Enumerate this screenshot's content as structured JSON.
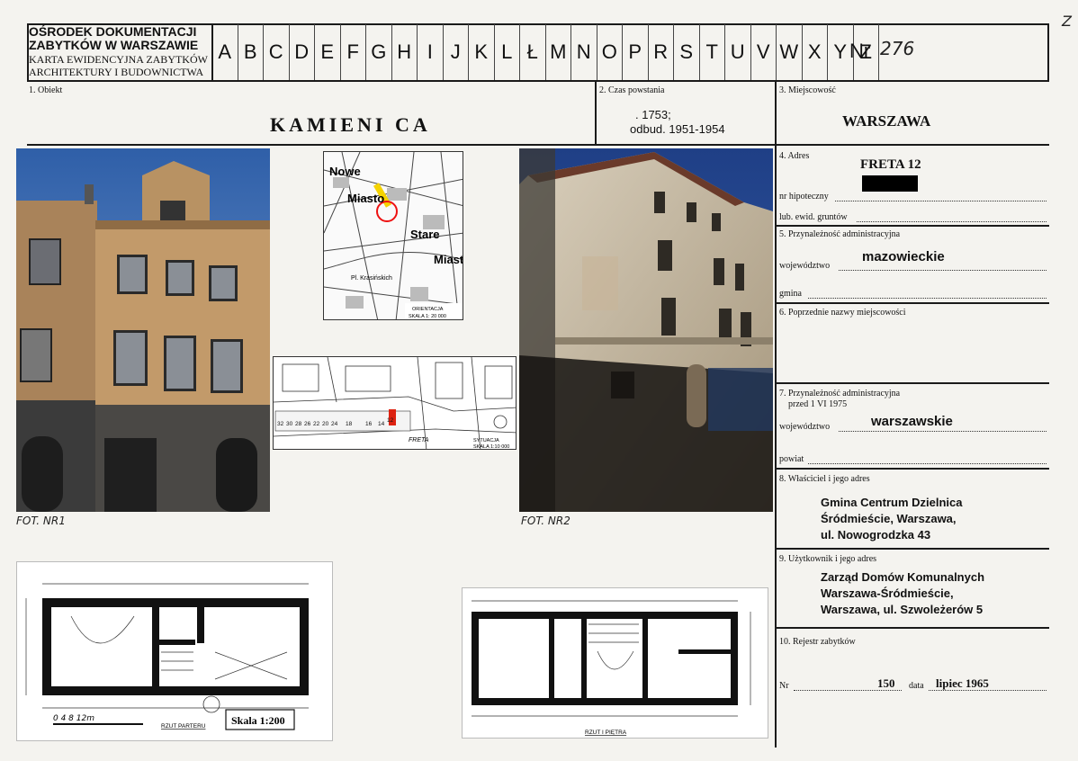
{
  "header": {
    "org_line1": "OŚRODEK DOKUMENTACJI",
    "org_line2": "ZABYTKÓW W WARSZAWIE",
    "card_line1": "KARTA EWIDENCYJNA ZABYTKÓW",
    "card_line2": "ARCHITEKTURY I BUDOWNICTWA",
    "letters": [
      "A",
      "B",
      "C",
      "D",
      "E",
      "F",
      "G",
      "H",
      "I",
      "J",
      "K",
      "L",
      "Ł",
      "M",
      "N",
      "O",
      "P",
      "R",
      "S",
      "T",
      "U",
      "V",
      "W",
      "X",
      "Y",
      "Z"
    ],
    "nr_label": "Nr",
    "nr_value": "276",
    "corner_mark": "Z"
  },
  "fields": {
    "obiekt_label": "1. Obiekt",
    "obiekt_value": "KAMIENI CA",
    "czas_label": "2. Czas powstania",
    "czas_value1": ". 1753;",
    "czas_value2": "odbud. 1951-1954",
    "miejscowosc_label": "3. Miejscowość",
    "miejscowosc_value": "WARSZAWA",
    "adres_label": "4. Adres",
    "adres_value": "FRETA 12",
    "nr_hipoteczny": "nr hipoteczny",
    "lub_ewid": "lub. ewid. gruntów",
    "przyn_label": "5. Przynależność administracyjna",
    "wojewodztwo": "województwo",
    "wojewodztwo_value": "mazowieckie",
    "gmina": "gmina",
    "poprz_label": "6. Poprzednie nazwy miejscowości",
    "przyn2_label1": "7. Przynależność administracyjna",
    "przyn2_label2": "przed 1 VI 1975",
    "wojewodztwo2_value": "warszawskie",
    "powiat": "powiat",
    "wlasciciel_label": "8. Właściciel i jego adres",
    "wlasciciel_1": "Gmina Centrum Dzielnica",
    "wlasciciel_2": "Śródmieście, Warszawa,",
    "wlasciciel_3": "ul. Nowogrodzka 43",
    "uzytkownik_label": "9. Użytkownik i jego adres",
    "uzytkownik_1": "Zarząd Domów Komunalnych",
    "uzytkownik_2": "Warszawa-Śródmieście,",
    "uzytkownik_3": "Warszawa, ul. Szwoleżerów 5",
    "rejestr_label": "10. Rejestr zabytków",
    "rejestr_nr_label": "Nr",
    "rejestr_nr_value": "150",
    "rejestr_data_label": "data",
    "rejestr_data_value": "lipiec 1965"
  },
  "images": {
    "foto1_caption": "FOT. NR1",
    "foto2_caption": "FOT. NR2",
    "map1_labels": [
      "Nowe",
      "Miasto",
      "Stare",
      "Miast",
      "Pl. Krasińskich"
    ],
    "map1_caption1": "ORIENTACJA",
    "map1_caption2": "SKALA 1: 20 000",
    "map2_caption1": "SYTUACJA",
    "map2_caption2": "SKALA 1:10 000",
    "map2_street": "FRETA",
    "map2_numbers": [
      "32",
      "30",
      "28",
      "26",
      "22",
      "20",
      "24",
      "18",
      "16",
      "14",
      "12"
    ],
    "plan1_scale": "Skala 1:200",
    "plan1_caption": "RZUT PARTERU",
    "plan1_ruler": "0 4 8 12m",
    "plan2_caption": "RZUT I PIĘTRA"
  }
}
